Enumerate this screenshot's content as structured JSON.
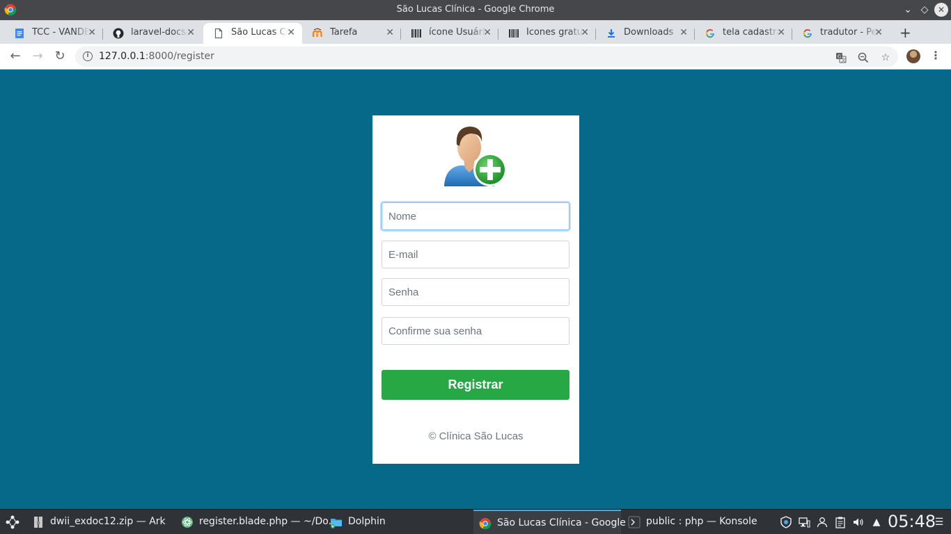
{
  "window": {
    "title": "São Lucas Clínica - Google Chrome"
  },
  "tabs": [
    {
      "label": "TCC - VANDE",
      "icon": "google-docs-icon"
    },
    {
      "label": "laravel-docs/",
      "icon": "github-icon"
    },
    {
      "label": "São Lucas Clí",
      "icon": "page-icon",
      "active": true
    },
    {
      "label": "Tarefa",
      "icon": "moodle-icon"
    },
    {
      "label": "ícone Usuári",
      "icon": "barcode-site-icon"
    },
    {
      "label": "Ícones gratu",
      "icon": "barcode-site-icon"
    },
    {
      "label": "Downloads",
      "icon": "download-icon"
    },
    {
      "label": "tela cadastra",
      "icon": "google-icon"
    },
    {
      "label": "tradutor - Pe",
      "icon": "google-icon"
    }
  ],
  "address_bar": {
    "host": "127.0.0.1",
    "path": ":8000/register"
  },
  "form": {
    "name_placeholder": "Nome",
    "email_placeholder": "E-mail",
    "password_placeholder": "Senha",
    "confirm_placeholder": "Confirme sua senha",
    "submit_label": "Registrar",
    "footer": "© Clínica São Lucas"
  },
  "taskbar": {
    "tasks": [
      {
        "label": "dwii_exdoc12.zip — Ark",
        "icon": "ark-archive-icon"
      },
      {
        "label": "register.blade.php — ~/Do...",
        "icon": "atom-editor-icon"
      },
      {
        "label": "Dolphin",
        "icon": "folder-icon"
      },
      {
        "label": "São Lucas Clínica - Google ...",
        "icon": "chrome-icon",
        "active": true
      },
      {
        "label": "public : php — Konsole",
        "icon": "terminal-icon"
      }
    ],
    "clock": "05:48"
  },
  "colors": {
    "page_background": "#07698a",
    "submit_button": "#28a745",
    "taskbar": "#2f3338"
  }
}
